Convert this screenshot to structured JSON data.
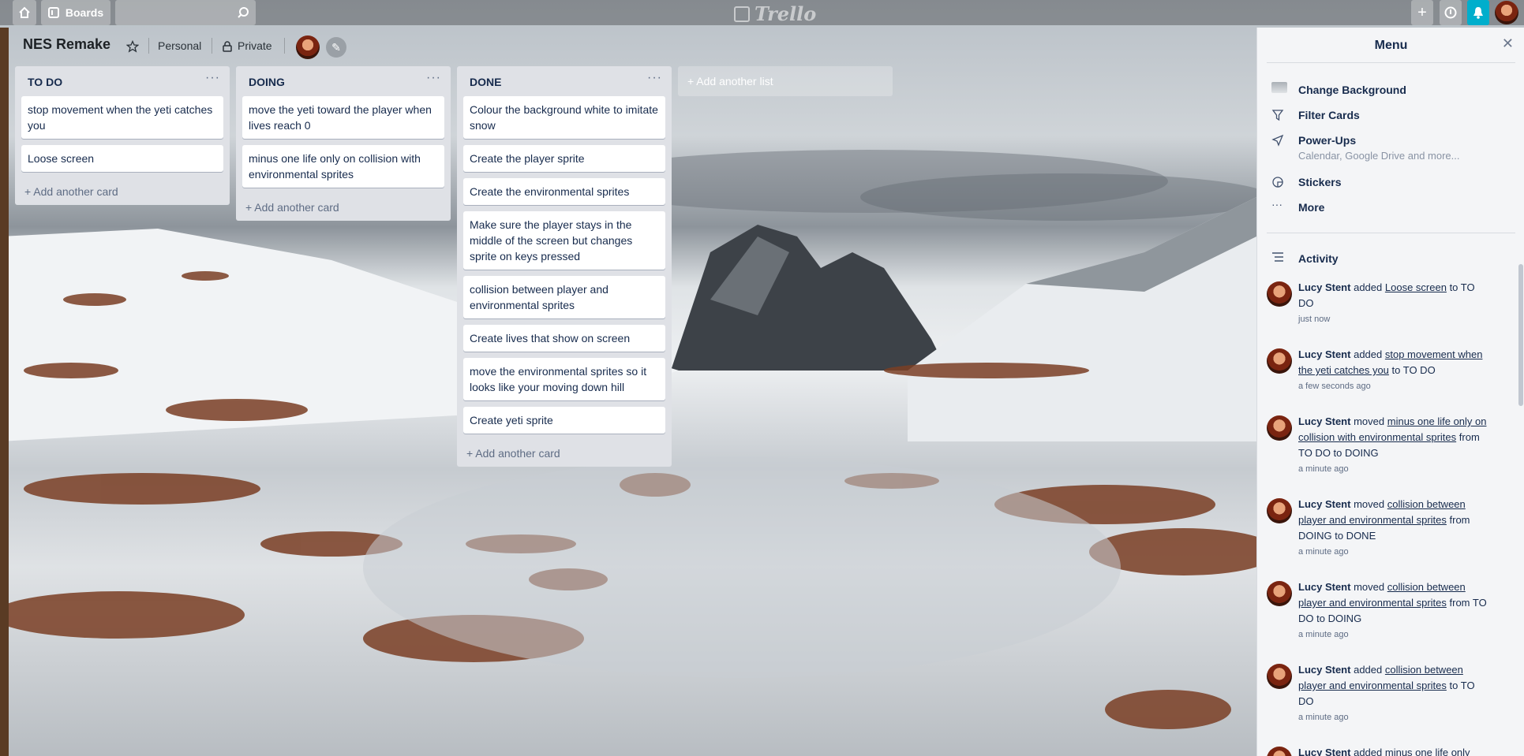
{
  "topbar": {
    "boards_label": "Boards",
    "logo_text": "Trello",
    "search_value": ""
  },
  "board": {
    "title": "NES Remake",
    "team": "Personal",
    "visibility": "Private"
  },
  "lists": [
    {
      "title": "TO DO",
      "cards": [
        "stop movement when the yeti catches you",
        "Loose screen"
      ],
      "add_card": "Add another card"
    },
    {
      "title": "DOING",
      "cards": [
        "move the yeti toward the player when lives reach 0",
        "minus one life only on collision with environmental sprites"
      ],
      "add_card": "Add another card"
    },
    {
      "title": "DONE",
      "cards": [
        "Colour the background white to imitate snow",
        "Create the player sprite",
        "Create the environmental sprites",
        "Make sure the player stays in the middle of the screen but changes sprite on keys pressed",
        "collision between player and environmental sprites",
        "Create lives that show on screen",
        "move the environmental sprites so it looks like your moving down hill",
        "Create yeti sprite"
      ],
      "add_card": "Add another card"
    }
  ],
  "add_list": "Add another list",
  "menu": {
    "title": "Menu",
    "items": [
      {
        "label": "Change Background",
        "icon": "background-thumbnail-icon"
      },
      {
        "label": "Filter Cards",
        "icon": "filter-icon"
      },
      {
        "label": "Power-Ups",
        "icon": "rocket-icon",
        "sub": "Calendar, Google Drive and more..."
      },
      {
        "label": "Stickers",
        "icon": "sticker-icon"
      },
      {
        "label": "More",
        "icon": "ellipsis-icon"
      }
    ],
    "activity_label": "Activity",
    "activity": [
      {
        "user": "Lucy Stent",
        "verb": "added",
        "link": "Loose screen",
        "rest": "to TO DO",
        "time": "just now"
      },
      {
        "user": "Lucy Stent",
        "verb": "added",
        "link": "stop movement when the yeti catches you",
        "rest": "to TO DO",
        "time": "a few seconds ago"
      },
      {
        "user": "Lucy Stent",
        "verb": "moved",
        "link": "minus one life only on collision with environmental sprites",
        "rest": "from TO DO to DOING",
        "time": "a minute ago"
      },
      {
        "user": "Lucy Stent",
        "verb": "moved",
        "link": "collision between player and environmental sprites",
        "rest": "from DOING to DONE",
        "time": "a minute ago"
      },
      {
        "user": "Lucy Stent",
        "verb": "moved",
        "link": "collision between player and environmental sprites",
        "rest": "from TO DO to DOING",
        "time": "a minute ago"
      },
      {
        "user": "Lucy Stent",
        "verb": "added",
        "link": "collision between player and environmental sprites",
        "rest": "to TO DO",
        "time": "a minute ago"
      },
      {
        "user": "Lucy Stent",
        "verb": "added",
        "link": "minus one life only",
        "rest": "",
        "time": ""
      }
    ]
  },
  "colors": {
    "list_bg": "#dfe1e6",
    "notification_accent": "#00aecc"
  }
}
